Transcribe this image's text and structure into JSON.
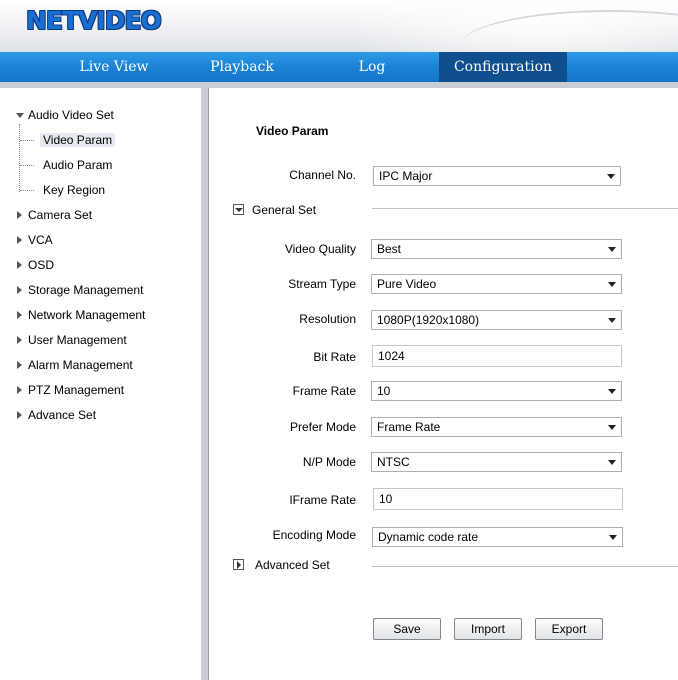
{
  "header": {
    "logo": "NETVIDEO"
  },
  "nav": {
    "tabs": [
      {
        "label": "Live View"
      },
      {
        "label": "Playback"
      },
      {
        "label": "Log"
      },
      {
        "label": "Configuration",
        "active": true
      }
    ]
  },
  "sidebar": {
    "group_open": "Audio Video Set",
    "sub_items": [
      "Video Param",
      "Audio Param",
      "Key Region"
    ],
    "selected": "Video Param",
    "items": [
      "Camera Set",
      "VCA",
      "OSD",
      "Storage Management",
      "Network Management",
      "User Management",
      "Alarm Management",
      "PTZ Management",
      "Advance Set"
    ]
  },
  "main": {
    "title": "Video Param",
    "channel": {
      "label": "Channel No.",
      "value": "IPC Major"
    },
    "general_set": "General Set",
    "fields": {
      "video_quality": {
        "label": "Video Quality",
        "value": "Best"
      },
      "stream_type": {
        "label": "Stream Type",
        "value": "Pure Video"
      },
      "resolution": {
        "label": "Resolution",
        "value": "1080P(1920x1080)"
      },
      "bit_rate": {
        "label": "Bit Rate",
        "value": "1024"
      },
      "frame_rate": {
        "label": "Frame Rate",
        "value": "10"
      },
      "prefer_mode": {
        "label": "Prefer Mode",
        "value": "Frame Rate"
      },
      "np_mode": {
        "label": "N/P Mode",
        "value": "NTSC"
      },
      "iframe_rate": {
        "label": "IFrame Rate",
        "value": "10"
      },
      "encoding_mode": {
        "label": "Encoding Mode",
        "value": "Dynamic code rate"
      }
    },
    "advanced_set": "Advanced Set",
    "buttons": {
      "save": "Save",
      "import": "Import",
      "export": "Export"
    }
  },
  "colors": {
    "nav_bar": "#1b82d6",
    "nav_active": "#0f4f8d",
    "logo": "#1b6fd3",
    "frame": "#c9ced4"
  }
}
